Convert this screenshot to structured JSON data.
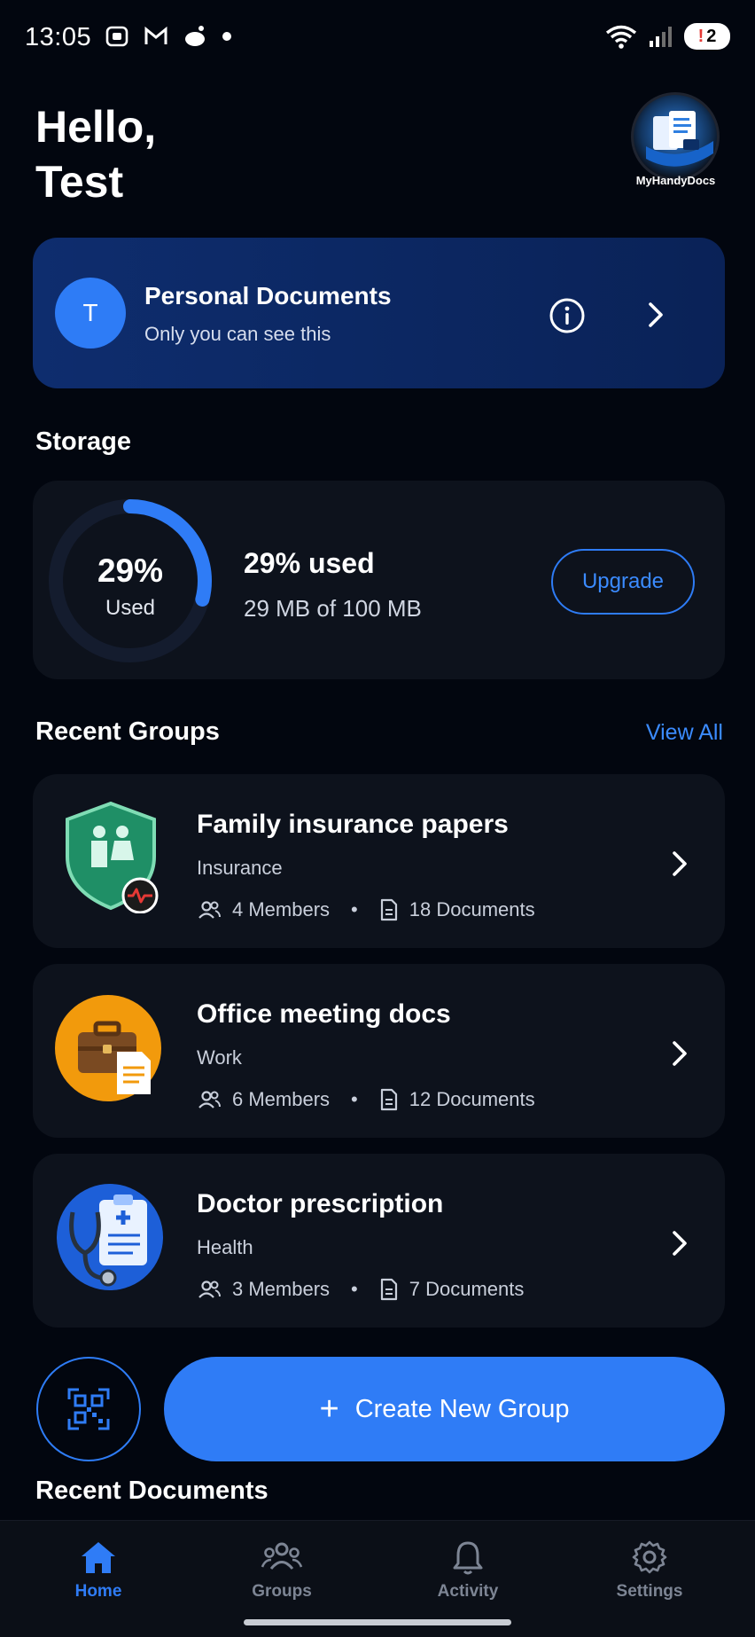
{
  "status_bar": {
    "time": "13:05",
    "battery_alert": "!",
    "battery_level": "2"
  },
  "greeting": {
    "line1": "Hello,",
    "line2": "Test"
  },
  "brand": {
    "logo_label": "MyHandyDocs"
  },
  "personal_documents": {
    "avatar_initial": "T",
    "title": "Personal Documents",
    "subtitle": "Only you can see this"
  },
  "storage": {
    "section_title": "Storage",
    "percent_label": "29%",
    "ring_caption": "Used",
    "used_text": "29% used",
    "detail_text": "29 MB of 100 MB",
    "used_fraction": 0.29,
    "upgrade_label": "Upgrade"
  },
  "recent_groups": {
    "section_title": "Recent Groups",
    "view_all_label": "View All",
    "items": [
      {
        "title": "Family insurance papers",
        "category": "Insurance",
        "members": "4 Members",
        "documents": "18 Documents",
        "icon": "shield-family-icon"
      },
      {
        "title": "Office meeting docs",
        "category": "Work",
        "members": "6 Members",
        "documents": "12 Documents",
        "icon": "briefcase-icon"
      },
      {
        "title": "Doctor prescription",
        "category": "Health",
        "members": "3 Members",
        "documents": "7 Documents",
        "icon": "stethoscope-icon"
      }
    ]
  },
  "actions": {
    "create_group_label": "Create New Group"
  },
  "recent_documents": {
    "section_title": "Recent Documents"
  },
  "bottom_nav": {
    "items": [
      {
        "label": "Home",
        "icon": "home-icon",
        "active": true
      },
      {
        "label": "Groups",
        "icon": "groups-icon",
        "active": false
      },
      {
        "label": "Activity",
        "icon": "bell-icon",
        "active": false
      },
      {
        "label": "Settings",
        "icon": "gear-icon",
        "active": false
      }
    ]
  },
  "colors": {
    "background": "#02060f",
    "accent": "#2f7cf6",
    "card": "#0d121c",
    "personal_card": "#0e2d6e"
  }
}
